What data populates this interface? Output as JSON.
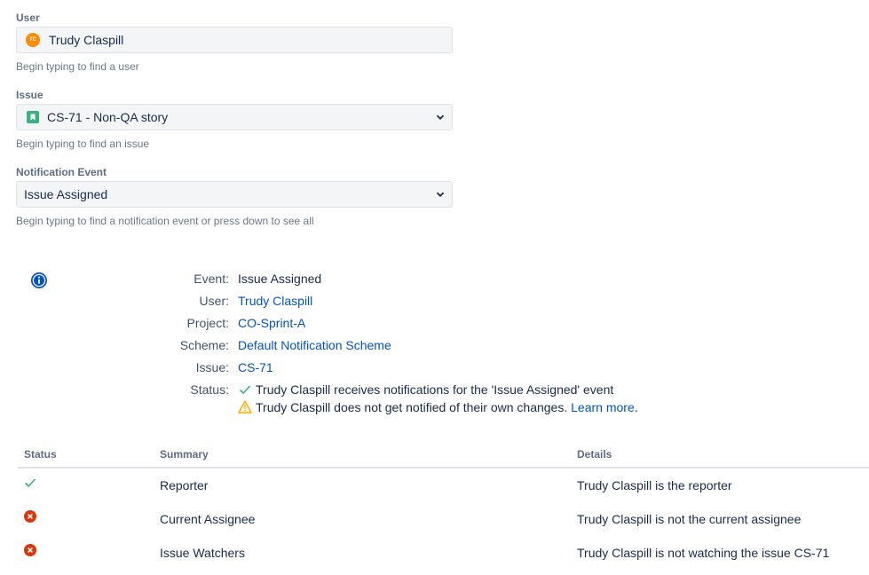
{
  "user_field": {
    "label": "User",
    "value": "Trudy Claspill",
    "avatar_initials": "TC",
    "helper": "Begin typing to find a user"
  },
  "issue_field": {
    "label": "Issue",
    "value": "CS-71 - Non-QA story",
    "helper": "Begin typing to find an issue"
  },
  "event_field": {
    "label": "Notification Event",
    "value": "Issue Assigned",
    "helper": "Begin typing to find a notification event or press down to see all"
  },
  "summary": {
    "event_label": "Event:",
    "event_value": "Issue Assigned",
    "user_label": "User:",
    "user_value": "Trudy Claspill",
    "project_label": "Project:",
    "project_value": "CO-Sprint-A",
    "scheme_label": "Scheme:",
    "scheme_value": "Default Notification Scheme",
    "issue_label": "Issue:",
    "issue_value": "CS-71",
    "status_label": "Status:",
    "status_ok": "Trudy Claspill receives notifications for the 'Issue Assigned' event",
    "status_warn": "Trudy Claspill does not get notified of their own changes.",
    "learn_more": "Learn more",
    "period": "."
  },
  "table": {
    "headers": {
      "status": "Status",
      "summary": "Summary",
      "details": "Details"
    },
    "rows": [
      {
        "status": "success",
        "summary": "Reporter",
        "details": "Trudy Claspill is the reporter"
      },
      {
        "status": "error",
        "summary": "Current Assignee",
        "details": "Trudy Claspill is not the current assignee"
      },
      {
        "status": "error",
        "summary": "Issue Watchers",
        "details": "Trudy Claspill is not watching the issue CS-71"
      }
    ]
  },
  "colors": {
    "link": "#0052cc",
    "success": "#36b37e",
    "error": "#de350b",
    "warning": "#ffab00",
    "info": "#0052cc"
  },
  "icons": [
    "avatar",
    "story-icon",
    "chevron-down-icon",
    "info-icon",
    "check-icon",
    "warning-icon",
    "error-icon"
  ]
}
